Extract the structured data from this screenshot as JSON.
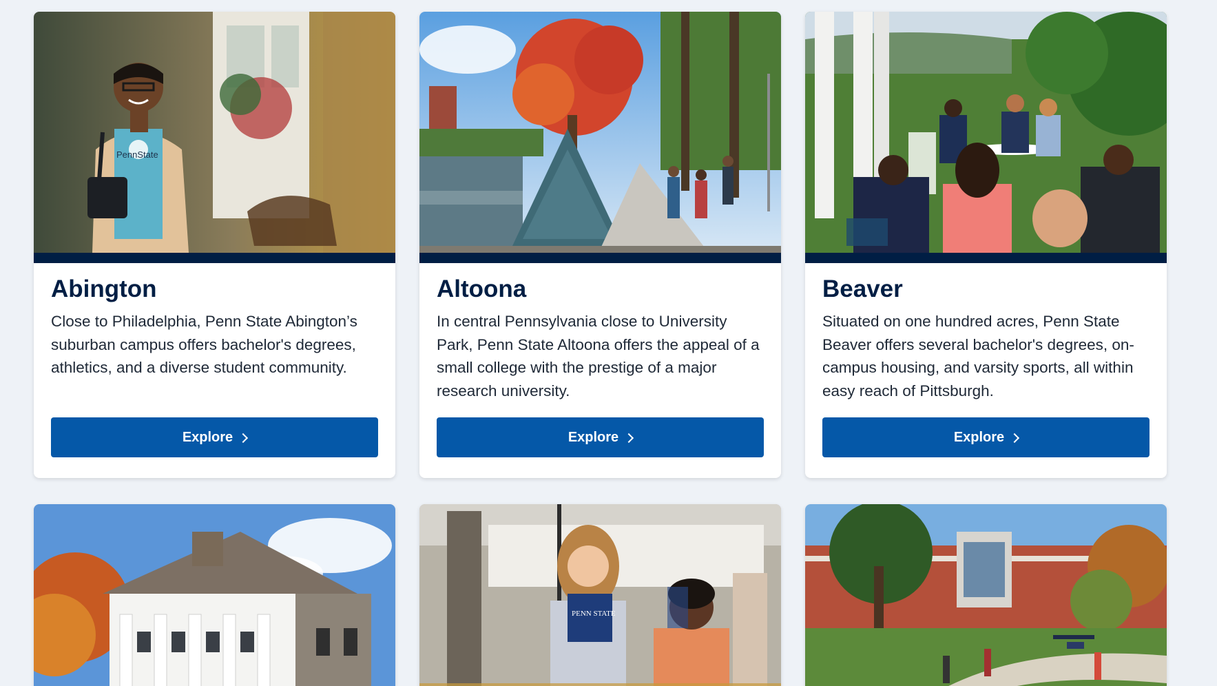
{
  "campuses": [
    {
      "name": "Abington",
      "description": "Close to Philadelphia, Penn State Abington’s suburban campus offers bachelor's degrees, athletics, and a diverse student community.",
      "button_label": "Explore"
    },
    {
      "name": "Altoona",
      "description": "In central Pennsylvania close to University Park, Penn State Altoona offers the appeal of a small college with the prestige of a major research university.",
      "button_label": "Explore"
    },
    {
      "name": "Beaver",
      "description": "Situated on one hundred acres, Penn State Beaver offers several bachelor's degrees, on-campus housing, and varsity sports, all within easy reach of Pittsburgh.",
      "button_label": "Explore"
    }
  ],
  "shirt_text": "PennState",
  "book_text": "PENN STATE",
  "colors": {
    "page_background": "#eef2f7",
    "navy": "#001e44",
    "button_blue": "#0558a8",
    "text": "#1f2937"
  }
}
